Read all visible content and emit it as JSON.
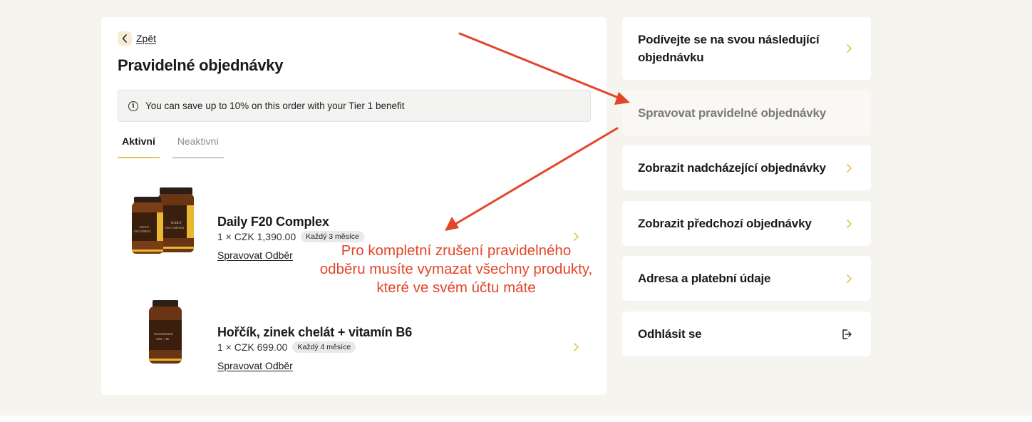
{
  "back": {
    "label": "Zpět"
  },
  "page": {
    "title": "Pravidelné objednávky"
  },
  "info_banner": {
    "text": "You can save up to 10% on this order with your Tier 1 benefit"
  },
  "tabs": [
    {
      "label": "Aktivní",
      "active": true
    },
    {
      "label": "Neaktivní",
      "active": false
    }
  ],
  "products": [
    {
      "name": "Daily F20 Complex",
      "price": "1 × CZK 1,390.00",
      "frequency": "Každý 3 měsíce",
      "manage_label": "Spravovat Odběr"
    },
    {
      "name": "Hořčík, zinek chelát + vitamín B6",
      "price": "1 × CZK 699.00",
      "frequency": "Každý 4 měsíce",
      "manage_label": "Spravovat Odběr"
    }
  ],
  "sidebar": {
    "items": [
      {
        "label": "Podívejte se na svou následující objednávku",
        "icon": "chevron-right-icon"
      },
      {
        "label": "Spravovat pravidelné objednávky",
        "active": true
      },
      {
        "label": "Zobrazit nadcházející objednávky",
        "icon": "chevron-right-icon"
      },
      {
        "label": "Zobrazit předchozí objednávky",
        "icon": "chevron-right-icon"
      },
      {
        "label": "Adresa a platební údaje",
        "icon": "chevron-right-icon"
      },
      {
        "label": "Odhlásit se",
        "icon": "logout-icon"
      }
    ]
  },
  "annotation": {
    "lines": [
      "Pro kompletní zrušení pravidelného",
      "odběru musíte vymazat všechny produkty,",
      "které ve svém účtu máte"
    ]
  },
  "colors": {
    "accent": "#e6c157",
    "annotation": "#e3452a",
    "page_background": "#f6f4ef"
  }
}
